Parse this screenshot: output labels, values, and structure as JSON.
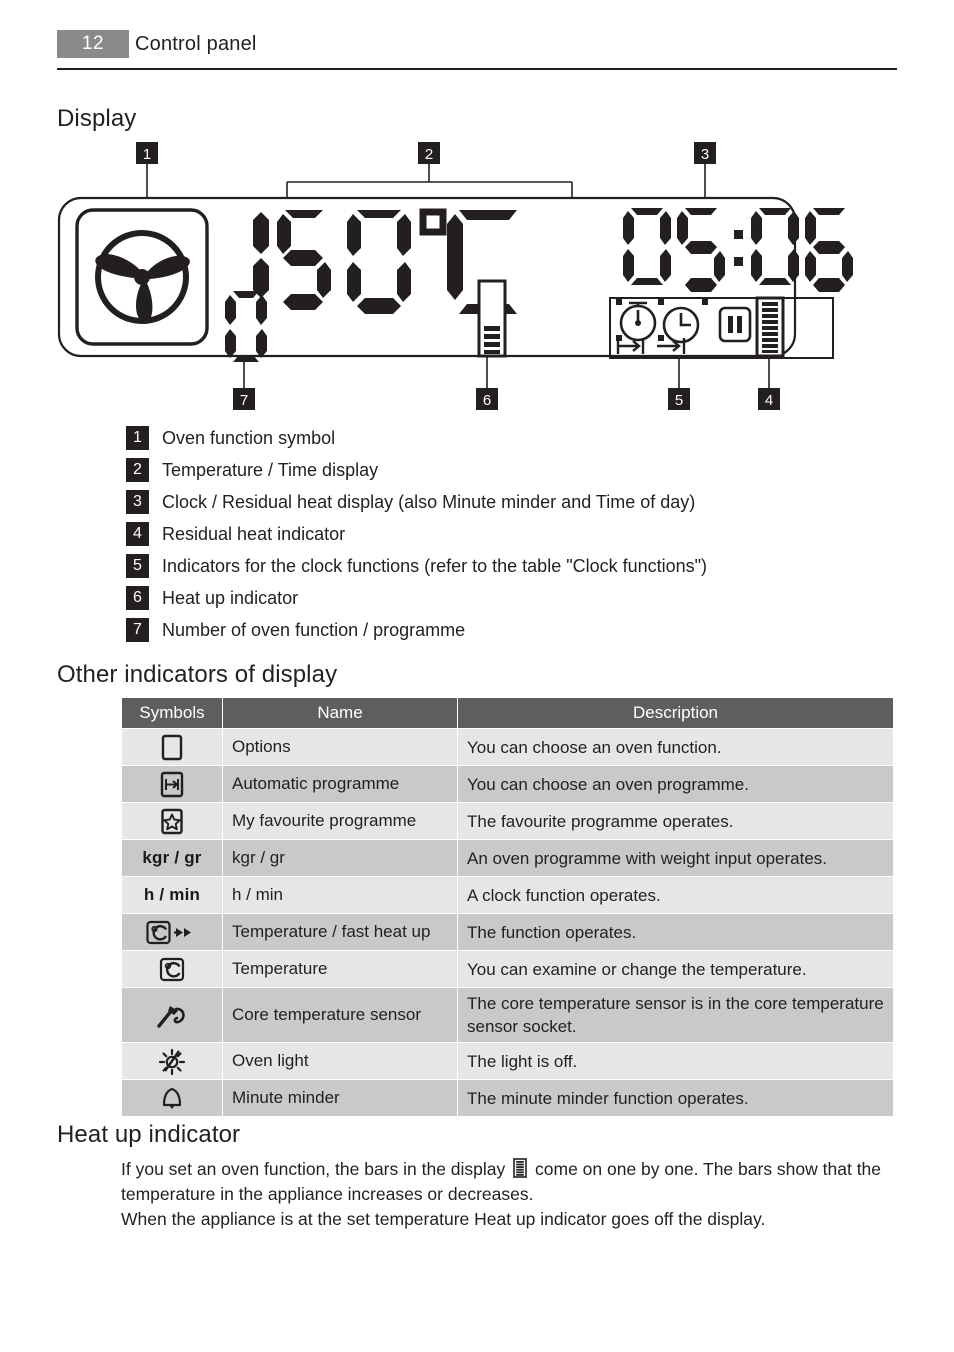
{
  "header": {
    "page_number": "12",
    "title": "Control panel"
  },
  "sections": {
    "display_heading": "Display",
    "other_indicators_heading": "Other indicators of display",
    "heat_up_heading": "Heat up indicator"
  },
  "display_diagram": {
    "temperature_value": "150°C",
    "clock_value": "05:06",
    "function_number": "0",
    "oven_function_icon": "fan-symbol",
    "heat_up_bars_filled": 4,
    "heat_up_bars_total": 12,
    "residual_heat_bars": 9,
    "clock_indicator_icons": [
      "stopwatch-icon",
      "clock-icon",
      "pause-icon",
      "duration-icon",
      "end-time-icon"
    ],
    "callouts": [
      {
        "number": "1",
        "position": "top-left"
      },
      {
        "number": "2",
        "position": "top-center"
      },
      {
        "number": "3",
        "position": "top-right"
      },
      {
        "number": "4",
        "position": "bottom-right"
      },
      {
        "number": "5",
        "position": "bottom-right-inner"
      },
      {
        "number": "6",
        "position": "bottom-center"
      },
      {
        "number": "7",
        "position": "bottom-left"
      }
    ]
  },
  "legend": [
    {
      "num": "1",
      "text": "Oven function symbol"
    },
    {
      "num": "2",
      "text": "Temperature / Time display"
    },
    {
      "num": "3",
      "text": "Clock / Residual heat display (also Minute minder and Time of day)"
    },
    {
      "num": "4",
      "text": "Residual heat indicator"
    },
    {
      "num": "5",
      "text": "Indicators for the clock functions (refer to the table \"Clock functions\")"
    },
    {
      "num": "6",
      "text": "Heat up indicator"
    },
    {
      "num": "7",
      "text": "Number of oven function / programme"
    }
  ],
  "table": {
    "columns": [
      "Symbols",
      "Name",
      "Description"
    ],
    "rows": [
      {
        "symbol_icon": "options-square-icon",
        "symbol_text": "",
        "name": "Options",
        "description": "You can choose an oven function."
      },
      {
        "symbol_icon": "automatic-programme-icon",
        "symbol_text": "",
        "name": "Automatic programme",
        "description": "You can choose an oven programme."
      },
      {
        "symbol_icon": "favourite-star-icon",
        "symbol_text": "",
        "name": "My favourite programme",
        "description": "The favourite programme operates."
      },
      {
        "symbol_icon": "",
        "symbol_text": "kgr / gr",
        "name": "kgr / gr",
        "description": "An oven programme with weight input operates."
      },
      {
        "symbol_icon": "",
        "symbol_text": "h / min",
        "name": "h / min",
        "description": "A clock function operates."
      },
      {
        "symbol_icon": "celsius-fast-heat-icon",
        "symbol_text": "",
        "name": "Temperature / fast heat up",
        "description": "The function operates."
      },
      {
        "symbol_icon": "celsius-icon",
        "symbol_text": "",
        "name": "Temperature",
        "description": "You can examine or change the temperature."
      },
      {
        "symbol_icon": "core-sensor-icon",
        "symbol_text": "",
        "name": "Core temperature sensor",
        "description": "The core temperature sensor is in the core temperature sensor socket."
      },
      {
        "symbol_icon": "oven-light-off-icon",
        "symbol_text": "",
        "name": "Oven light",
        "description": "The light is off."
      },
      {
        "symbol_icon": "bell-icon",
        "symbol_text": "",
        "name": "Minute minder",
        "description": "The minute minder function operates."
      }
    ]
  },
  "heat_up": {
    "line1_before_icon": "If you set an oven function, the bars in the display",
    "line1_after_icon": "come on one by one. The bars show that the temperature in the appliance increases or decreases.",
    "line2": "When the appliance is at the set temperature Heat up indicator goes off the display."
  },
  "colors": {
    "ink": "#231f20",
    "page_number_bg": "#8a8a8a",
    "table_header_bg": "#5e5e5e",
    "row_light": "#e6e6e6",
    "row_dark": "#c9c9c9"
  }
}
